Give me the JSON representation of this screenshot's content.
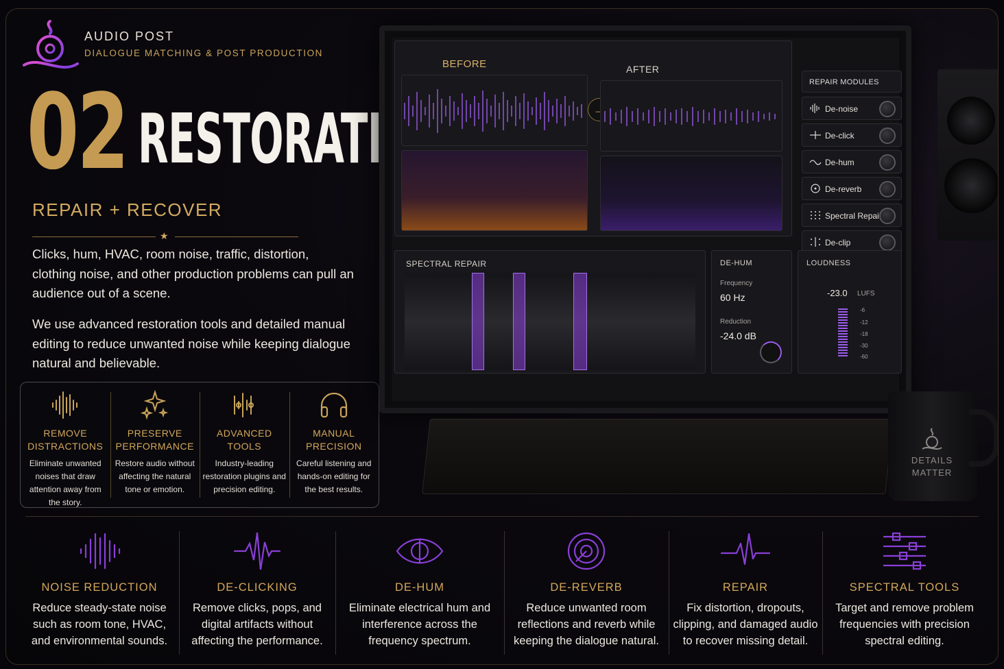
{
  "brand": {
    "name": "AUDIO POST",
    "subtitle": "DIALOGUE MATCHING & POST PRODUCTION"
  },
  "hero": {
    "number": "02",
    "title": "RESTORATION",
    "subtitle": "REPAIR + RECOVER"
  },
  "body": {
    "p1": "Clicks, hum, HVAC, room noise, traffic, distortion, clothing noise, and other production problems can pull an audience out of a scene.",
    "p2": "We use advanced restoration tools and detailed manual editing to reduce unwanted noise while keeping dialogue natural and believable."
  },
  "features": [
    {
      "icon": "waveform-icon",
      "title1": "REMOVE",
      "title2": "DISTRACTIONS",
      "desc": "Eliminate unwanted noises that draw attention away from the story."
    },
    {
      "icon": "sparkle-icon",
      "title1": "PRESERVE",
      "title2": "PERFORMANCE",
      "desc": "Restore audio without affecting the natural tone or emotion."
    },
    {
      "icon": "plugin-waveform-icon",
      "title1": "ADVANCED",
      "title2": "TOOLS",
      "desc": "Industry-leading restoration plugins and precision editing."
    },
    {
      "icon": "headphones-icon",
      "title1": "MANUAL",
      "title2": "PRECISION",
      "desc": "Careful listening and hands-on editing for the best results."
    }
  ],
  "screen": {
    "before_label": "BEFORE",
    "after_label": "AFTER",
    "modules_title": "REPAIR MODULES",
    "modules": [
      "De-noise",
      "De-click",
      "De-hum",
      "De-reverb",
      "Spectral Repair",
      "De-clip"
    ],
    "spectral_repair_label": "SPECTRAL REPAIR",
    "dehum": {
      "title": "DE-HUM",
      "freq_label": "Frequency",
      "freq_value": "60 Hz",
      "red_label": "Reduction",
      "red_value": "-24.0 dB"
    },
    "loudness": {
      "title": "LOUDNESS",
      "value": "-23.0",
      "unit": "LUFS",
      "scale": [
        "-6",
        "-12",
        "-18",
        "-30",
        "-60"
      ]
    }
  },
  "mug": {
    "line1": "DETAILS",
    "line2": "MATTER"
  },
  "services": [
    {
      "icon": "noise-reduction-icon",
      "title": "NOISE REDUCTION",
      "desc": "Reduce steady-state noise such as room tone, HVAC, and environmental sounds."
    },
    {
      "icon": "declick-icon",
      "title": "DE-CLICKING",
      "desc": "Remove clicks, pops, and digital artifacts without affecting the performance."
    },
    {
      "icon": "dehum-icon",
      "title": "DE-HUM",
      "desc": "Eliminate electrical hum and interference across the frequency spectrum."
    },
    {
      "icon": "dereverb-icon",
      "title": "DE-REVERB",
      "desc": "Reduce unwanted room reflections and reverb while keeping the dialogue natural."
    },
    {
      "icon": "repair-pulse-icon",
      "title": "REPAIR",
      "desc": "Fix distortion, dropouts, clipping, and damaged audio to recover missing detail."
    },
    {
      "icon": "spectral-sliders-icon",
      "title": "SPECTRAL TOOLS",
      "desc": "Target and remove problem frequencies with precision spectral editing."
    }
  ],
  "colors": {
    "gold": "#c59a52",
    "purple": "#8a3fd8",
    "magenta": "#c43fd0"
  }
}
